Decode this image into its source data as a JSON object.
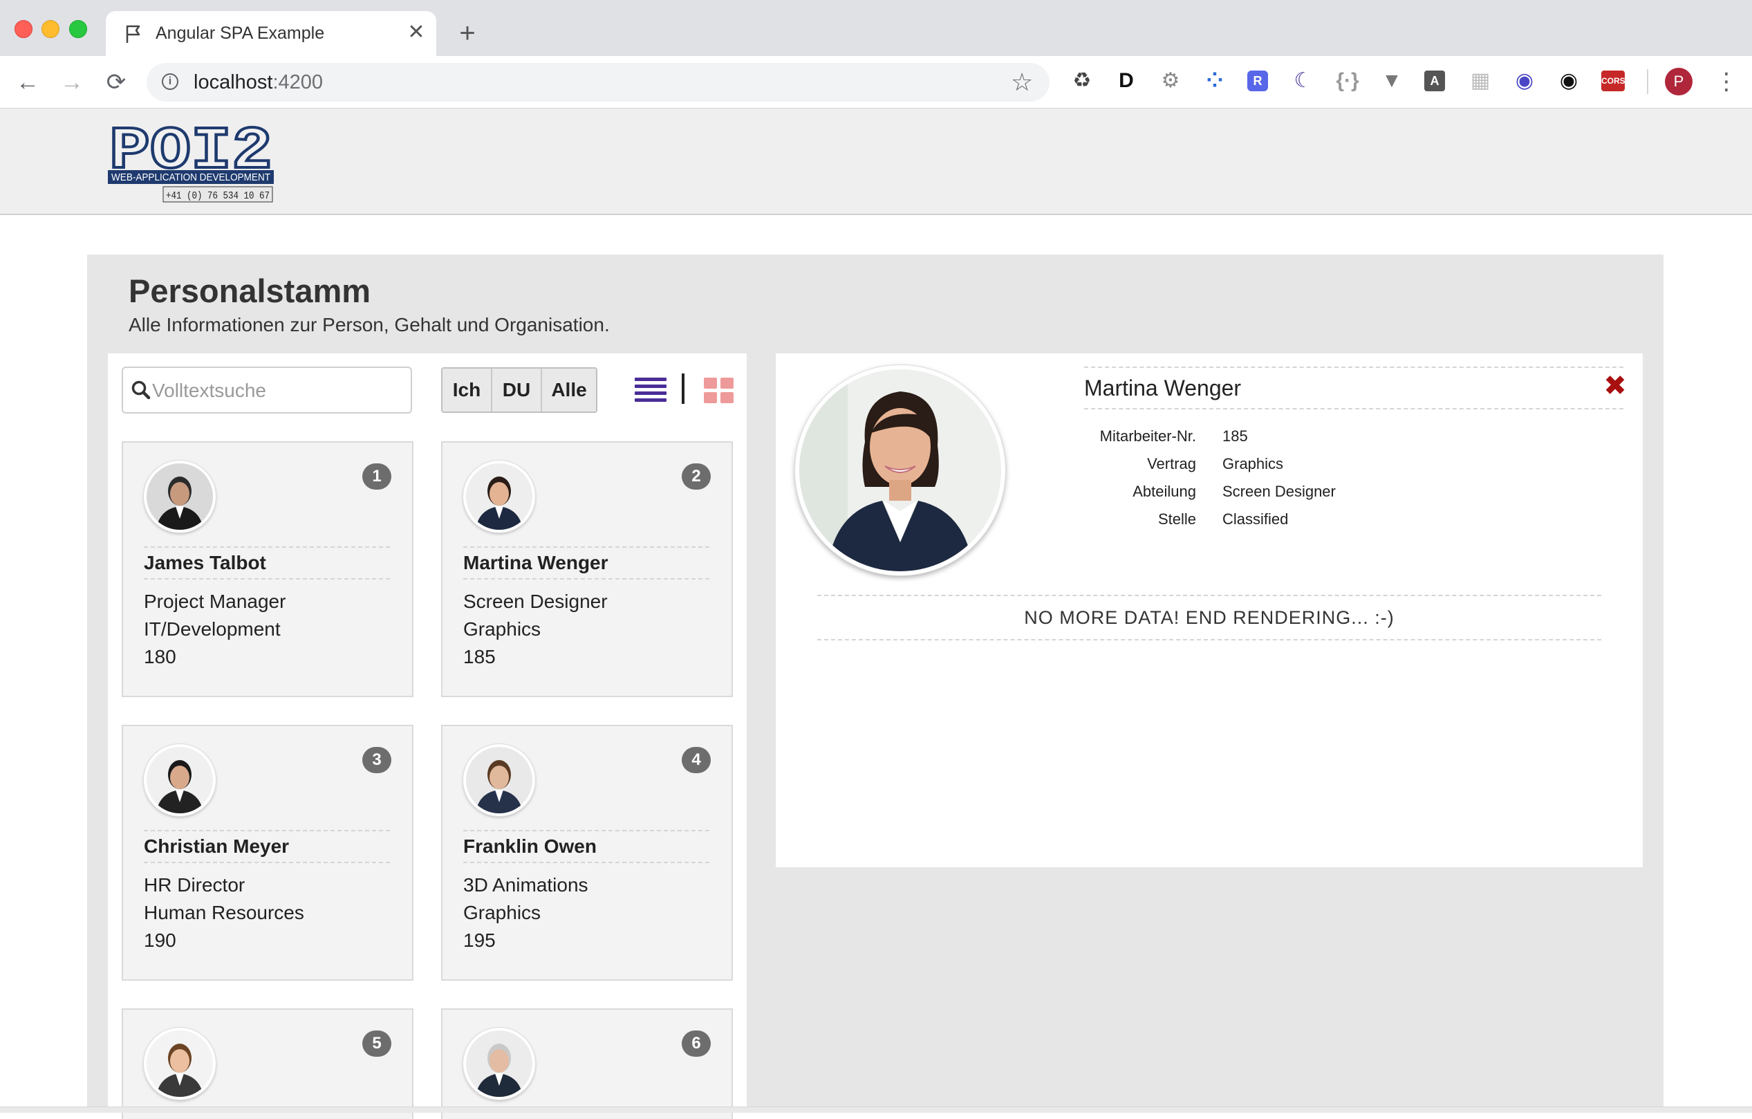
{
  "browser": {
    "tab_title": "Angular SPA Example",
    "tab_close": "✕",
    "new_tab": "+",
    "back": "←",
    "forward": "→",
    "reload": "⟳",
    "url_host": "localhost",
    "url_port": ":4200",
    "bookmark": "☆",
    "profile_initial": "P",
    "menu": "⋮",
    "extensions": [
      {
        "name": "recycle-extension-icon",
        "glyph": "♻",
        "color": "#444444"
      },
      {
        "name": "d-extension-icon",
        "glyph": "D",
        "color": "#111111"
      },
      {
        "name": "gear-extension-icon",
        "glyph": "⚙",
        "color": "#888888"
      },
      {
        "name": "dots-extension-icon",
        "glyph": "⁘",
        "color": "#2a6ad8"
      },
      {
        "name": "r-extension-icon",
        "glyph": "R",
        "color": "#5867e8"
      },
      {
        "name": "moon-extension-icon",
        "glyph": "☾",
        "color": "#4b3aa0"
      },
      {
        "name": "json-extension-icon",
        "glyph": "{·}",
        "color": "#999999"
      },
      {
        "name": "vue-extension-icon",
        "glyph": "▼",
        "color": "#777777"
      },
      {
        "name": "angular-extension-icon",
        "glyph": "A",
        "color": "#555555"
      },
      {
        "name": "grid-extension-icon",
        "glyph": "▦",
        "color": "#bbbbbb"
      },
      {
        "name": "target-extension-icon",
        "glyph": "◉",
        "color": "#4a47c4"
      },
      {
        "name": "eye-extension-icon",
        "glyph": "◉",
        "color": "#111111"
      },
      {
        "name": "cors-extension-icon",
        "glyph": "CORS",
        "color": "#c62828"
      }
    ]
  },
  "logo": {
    "brand": "POI2",
    "tagline": "WEB-APPLICATION DEVELOPMENT",
    "phone": "+41 (0) 76 534 10 67"
  },
  "page": {
    "title": "Personalstamm",
    "subtitle": "Alle Informationen zur Person, Gehalt und Organisation."
  },
  "search": {
    "placeholder": "Volltextsuche"
  },
  "filters": [
    "Ich",
    "DU",
    "Alle"
  ],
  "employees": [
    {
      "badge": "1",
      "name": "James Talbot",
      "line1": "Project Manager",
      "line2": "IT/Development",
      "line3": "180"
    },
    {
      "badge": "2",
      "name": "Martina Wenger",
      "line1": "Screen Designer",
      "line2": "Graphics",
      "line3": "185"
    },
    {
      "badge": "3",
      "name": "Christian Meyer",
      "line1": "HR Director",
      "line2": "Human Resources",
      "line3": "190"
    },
    {
      "badge": "4",
      "name": "Franklin Owen",
      "line1": "3D Animations",
      "line2": "Graphics",
      "line3": "195"
    },
    {
      "badge": "5"
    },
    {
      "badge": "6"
    }
  ],
  "detail": {
    "name": "Martina Wenger",
    "close": "✖",
    "fields": [
      {
        "label": "Mitarbeiter-Nr.",
        "value": "185"
      },
      {
        "label": "Vertrag",
        "value": "Graphics"
      },
      {
        "label": "Abteilung",
        "value": "Screen Designer"
      },
      {
        "label": "Stelle",
        "value": "Classified"
      }
    ],
    "end_message": "NO MORE DATA! END RENDERING... :-)"
  },
  "colors": {
    "list_view_icon": "#4a2d97",
    "grid_view_icon": "#ef9a9a",
    "close_icon": "#a81010",
    "badge": "#6d6d6d",
    "logo_blue": "#1e3a6e"
  }
}
